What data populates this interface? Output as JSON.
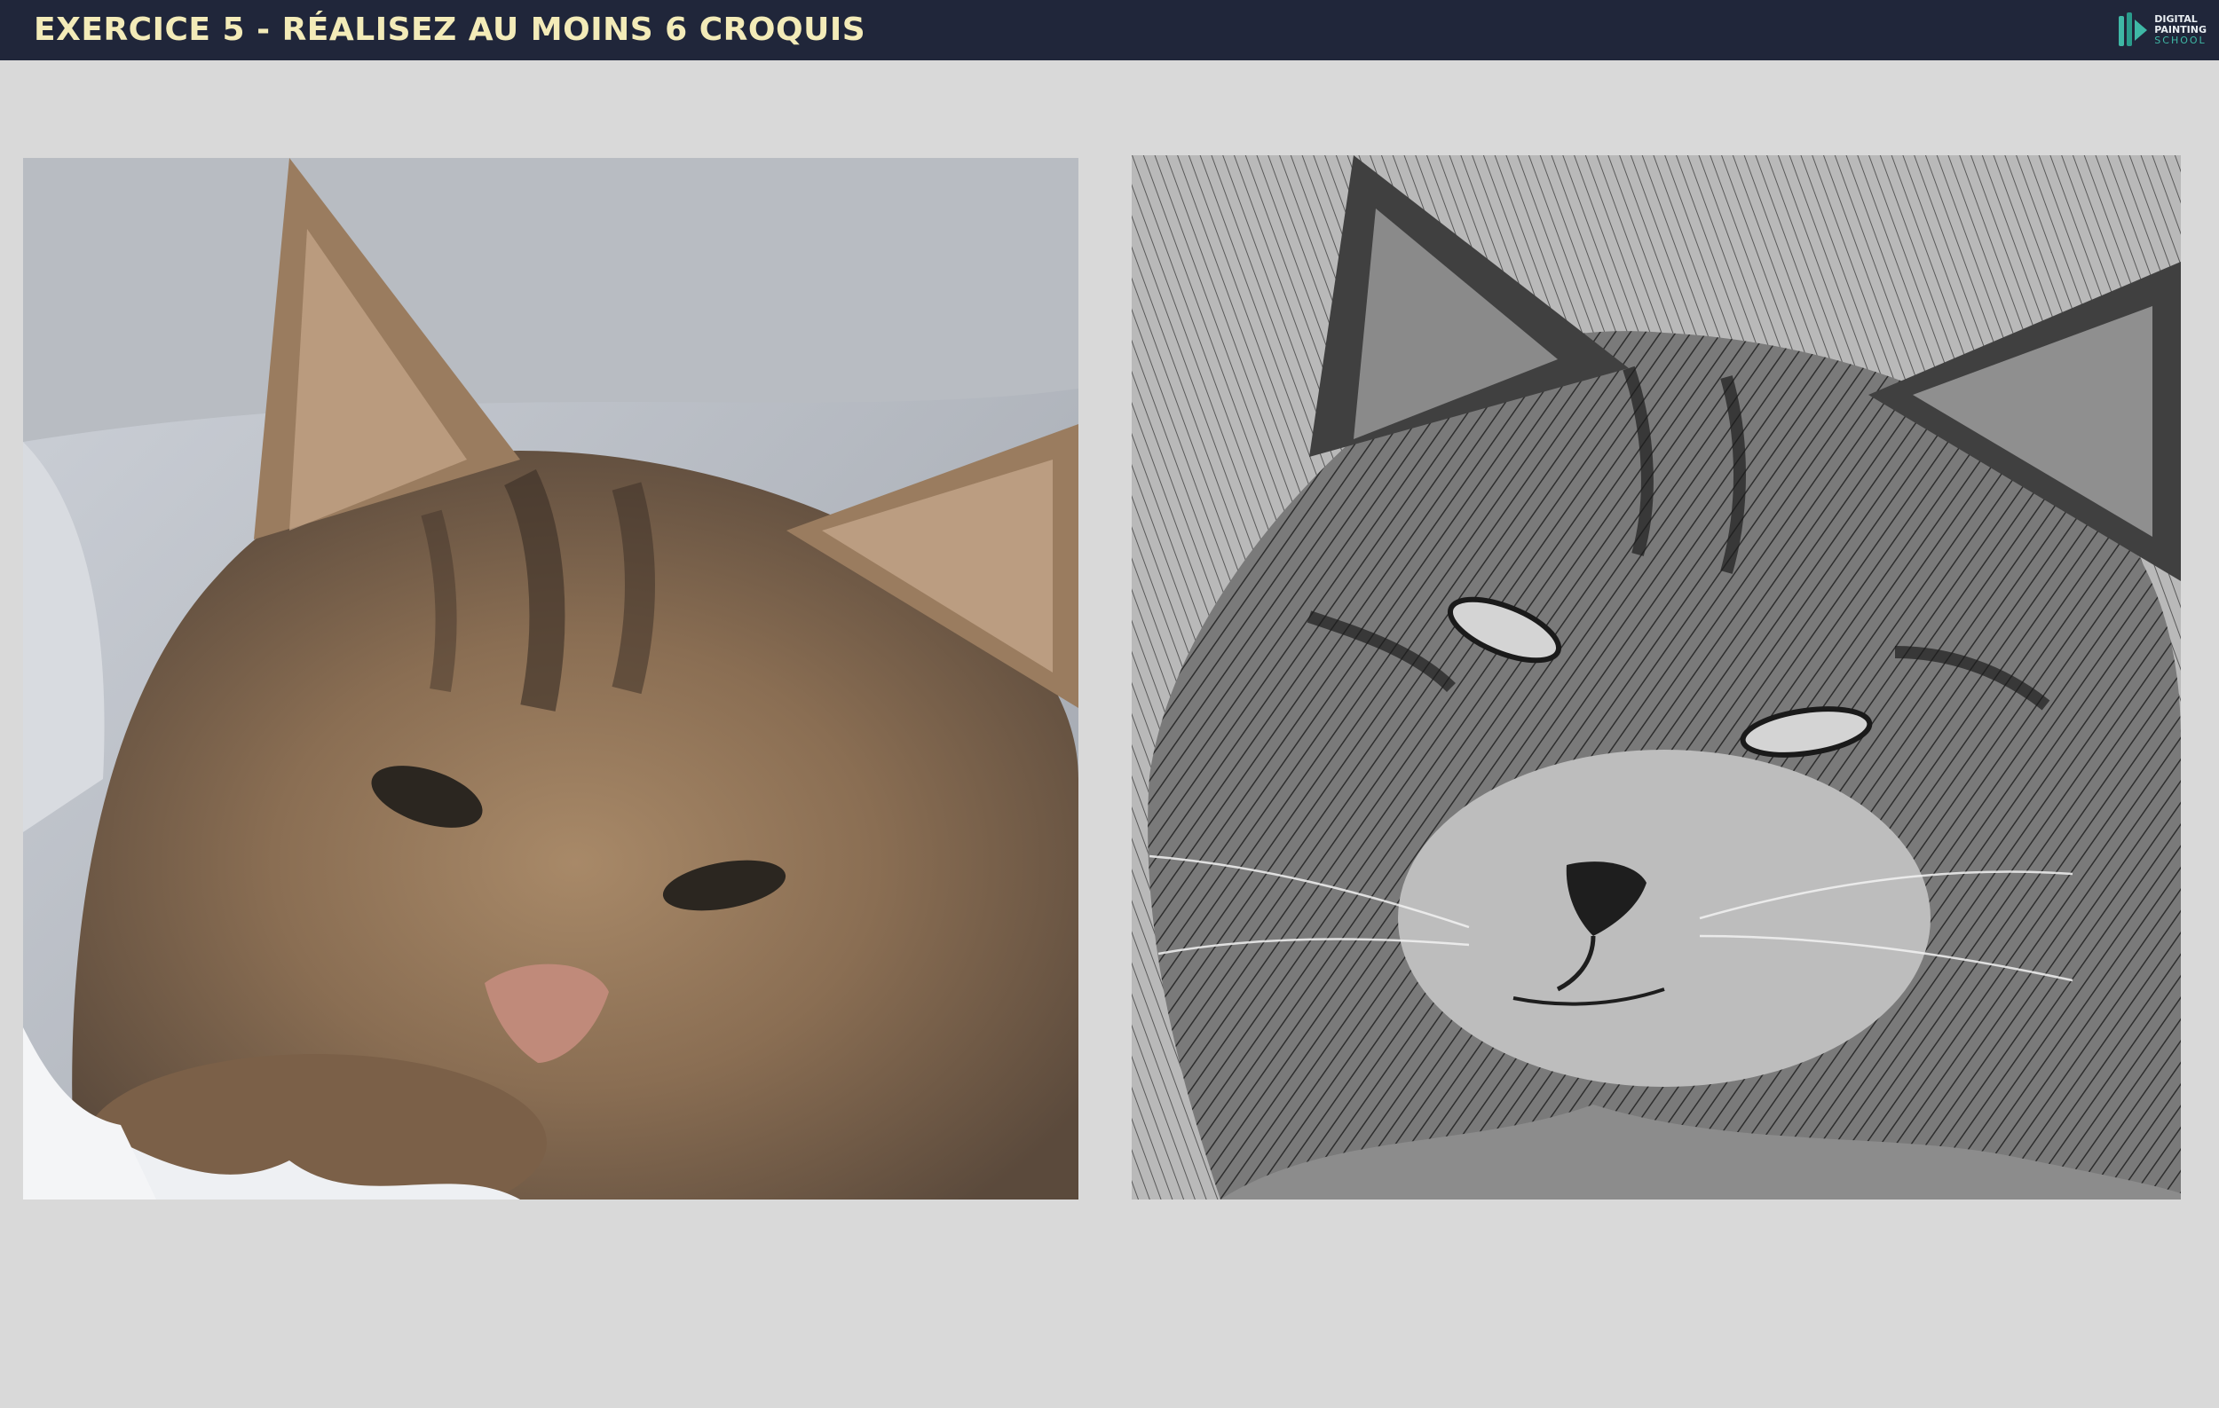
{
  "header": {
    "title": "EXERCICE 5 - RÉALISEZ AU MOINS 6 CROQUIS",
    "logo": {
      "line1": "DIGITAL",
      "line2": "PAINTING",
      "line3": "SCHOOL"
    }
  },
  "colors": {
    "header_bg": "#20263a",
    "title_text": "#f3ebb8",
    "page_bg": "#d9d9d9",
    "logo_accent": "#3fb8a6"
  },
  "images": {
    "reference": {
      "icon": "kitten-photo"
    },
    "sketch": {
      "icon": "kitten-sketch"
    }
  }
}
